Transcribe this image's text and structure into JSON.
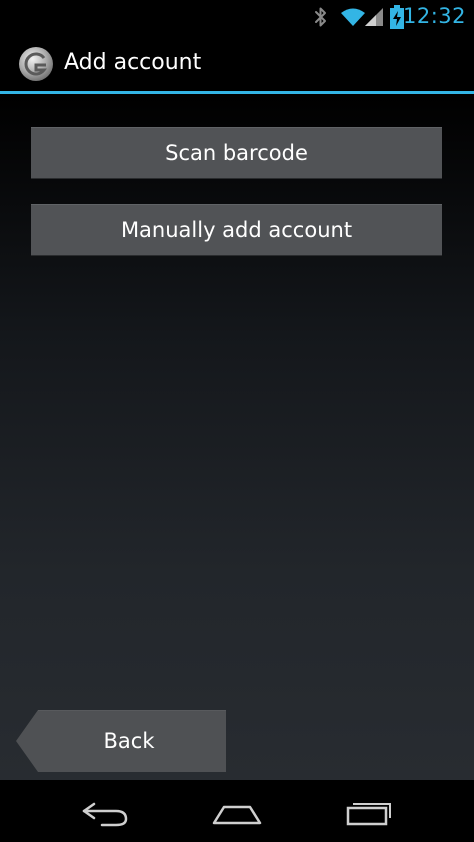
{
  "status_bar": {
    "time": "12:32",
    "icons": [
      "bluetooth-icon",
      "wifi-icon",
      "signal-icon",
      "battery-charging-icon"
    ],
    "accent_color": "#33b5e5"
  },
  "action_bar": {
    "title": "Add account",
    "logo_icon": "app-logo-icon",
    "underline_color": "#33b5e5"
  },
  "main": {
    "scan_barcode_label": "Scan barcode",
    "manual_add_label": "Manually add account",
    "back_label": "Back"
  },
  "nav_bar": {
    "icons": [
      "back-arrow-icon",
      "home-icon",
      "recent-apps-icon"
    ]
  }
}
